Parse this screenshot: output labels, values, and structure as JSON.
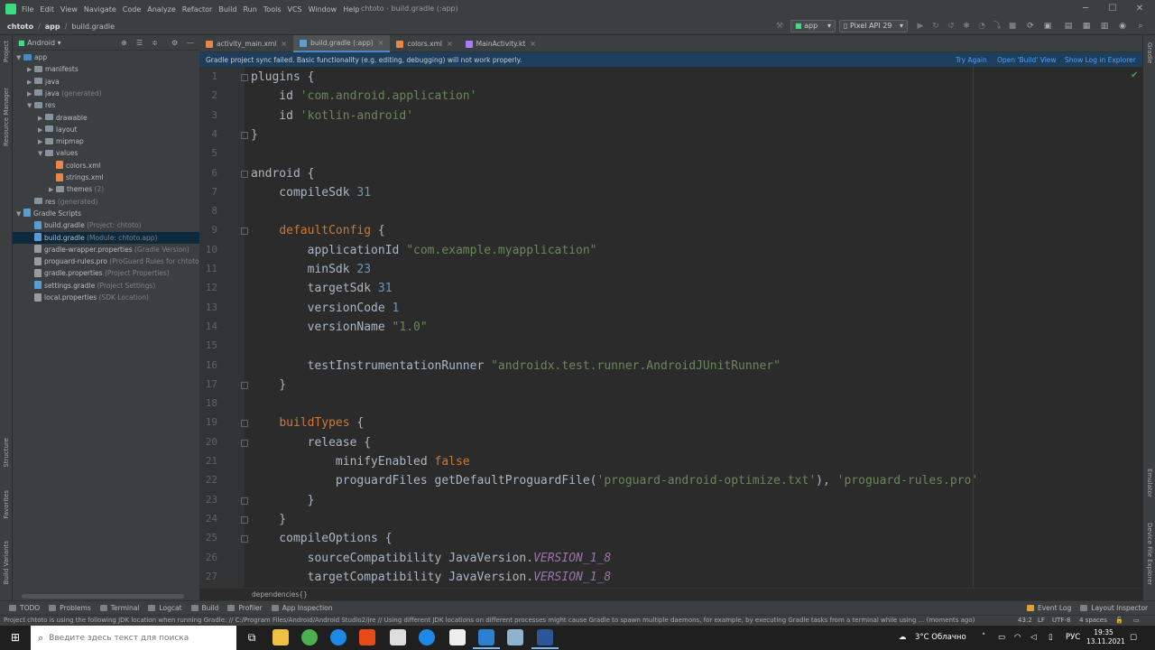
{
  "window": {
    "title": "chtoto - build.gradle (:app)",
    "menu": [
      "File",
      "Edit",
      "View",
      "Navigate",
      "Code",
      "Analyze",
      "Refactor",
      "Build",
      "Run",
      "Tools",
      "VCS",
      "Window",
      "Help"
    ],
    "controls": {
      "minimize": "─",
      "maximize": "☐",
      "close": "✕"
    }
  },
  "navbar": {
    "breadcrumbs": [
      "chtoto",
      "app",
      "build.gradle"
    ],
    "run_config": "app",
    "device": "Pixel API 29"
  },
  "sidebar_left": {
    "project": "Project",
    "resource_manager": "Resource Manager",
    "structure": "Structure",
    "favorites": "Favorites",
    "build_variants": "Build Variants"
  },
  "sidebar_right": {
    "gradle": "Gradle",
    "emulator": "Emulator",
    "device_explorer": "Device File Explorer"
  },
  "project_panel": {
    "view_mode": "Android",
    "tree": [
      {
        "label": "app",
        "hint": "",
        "indent": 0,
        "arrow": "▼",
        "icon": "folder-blue"
      },
      {
        "label": "manifests",
        "hint": "",
        "indent": 1,
        "arrow": "▶",
        "icon": "folder"
      },
      {
        "label": "java",
        "hint": "",
        "indent": 1,
        "arrow": "▶",
        "icon": "folder"
      },
      {
        "label": "java",
        "hint": " (generated)",
        "indent": 1,
        "arrow": "▶",
        "icon": "folder"
      },
      {
        "label": "res",
        "hint": "",
        "indent": 1,
        "arrow": "▼",
        "icon": "folder"
      },
      {
        "label": "drawable",
        "hint": "",
        "indent": 2,
        "arrow": "▶",
        "icon": "folder"
      },
      {
        "label": "layout",
        "hint": "",
        "indent": 2,
        "arrow": "▶",
        "icon": "folder"
      },
      {
        "label": "mipmap",
        "hint": "",
        "indent": 2,
        "arrow": "▶",
        "icon": "folder"
      },
      {
        "label": "values",
        "hint": "",
        "indent": 2,
        "arrow": "▼",
        "icon": "folder"
      },
      {
        "label": "colors.xml",
        "hint": "",
        "indent": 3,
        "arrow": "",
        "icon": "xml"
      },
      {
        "label": "strings.xml",
        "hint": "",
        "indent": 3,
        "arrow": "",
        "icon": "xml"
      },
      {
        "label": "themes",
        "hint": " (2)",
        "indent": 3,
        "arrow": "▶",
        "icon": "folder"
      },
      {
        "label": "res",
        "hint": " (generated)",
        "indent": 1,
        "arrow": "",
        "icon": "folder"
      },
      {
        "label": "Gradle Scripts",
        "hint": "",
        "indent": 0,
        "arrow": "▼",
        "icon": "gradle"
      },
      {
        "label": "build.gradle",
        "hint": " (Project: chtoto)",
        "indent": 1,
        "arrow": "",
        "icon": "gradle"
      },
      {
        "label": "build.gradle",
        "hint": " (Module: chtoto.app)",
        "indent": 1,
        "arrow": "",
        "icon": "gradle",
        "selected": true
      },
      {
        "label": "gradle-wrapper.properties",
        "hint": " (Gradle Version)",
        "indent": 1,
        "arrow": "",
        "icon": "props"
      },
      {
        "label": "proguard-rules.pro",
        "hint": " (ProGuard Rules for chtoto",
        "indent": 1,
        "arrow": "",
        "icon": "props"
      },
      {
        "label": "gradle.properties",
        "hint": " (Project Properties)",
        "indent": 1,
        "arrow": "",
        "icon": "props"
      },
      {
        "label": "settings.gradle",
        "hint": " (Project Settings)",
        "indent": 1,
        "arrow": "",
        "icon": "gradle"
      },
      {
        "label": "local.properties",
        "hint": " (SDK Location)",
        "indent": 1,
        "arrow": "",
        "icon": "props"
      }
    ]
  },
  "tabs": [
    {
      "label": "activity_main.xml",
      "color": "#e8864a",
      "active": false
    },
    {
      "label": "build.gradle (:app)",
      "color": "#5a9bd0",
      "active": true
    },
    {
      "label": "colors.xml",
      "color": "#e8864a",
      "active": false
    },
    {
      "label": "MainActivity.kt",
      "color": "#a97bff",
      "active": false
    }
  ],
  "banner": {
    "message": "Gradle project sync failed. Basic functionality (e.g. editing, debugging) will not work properly.",
    "try_again": "Try Again",
    "open_build": "Open 'Build' View",
    "show_log": "Show Log in Explorer"
  },
  "code_lines": [
    [
      [
        "i",
        "plugins {"
      ]
    ],
    [
      [
        "i",
        "    id "
      ],
      [
        "s",
        "'com.android.application'"
      ]
    ],
    [
      [
        "i",
        "    id "
      ],
      [
        "s",
        "'kotlin-android'"
      ]
    ],
    [
      [
        "i",
        "}"
      ]
    ],
    [],
    [
      [
        "i",
        "android {"
      ]
    ],
    [
      [
        "i",
        "    compileSdk "
      ],
      [
        "n",
        "31"
      ]
    ],
    [],
    [
      [
        "i",
        "    "
      ],
      [
        "k",
        "defaultConfig"
      ],
      [
        "i",
        " {"
      ]
    ],
    [
      [
        "i",
        "        applicationId "
      ],
      [
        "s",
        "\"com.example.myapplication\""
      ]
    ],
    [
      [
        "i",
        "        minSdk "
      ],
      [
        "n",
        "23"
      ]
    ],
    [
      [
        "i",
        "        targetSdk "
      ],
      [
        "n",
        "31"
      ]
    ],
    [
      [
        "i",
        "        versionCode "
      ],
      [
        "n",
        "1"
      ]
    ],
    [
      [
        "i",
        "        versionName "
      ],
      [
        "s",
        "\"1.0\""
      ]
    ],
    [],
    [
      [
        "i",
        "        testInstrumentationRunner "
      ],
      [
        "s",
        "\"androidx.test.runner.AndroidJUnitRunner\""
      ]
    ],
    [
      [
        "i",
        "    }"
      ]
    ],
    [],
    [
      [
        "i",
        "    "
      ],
      [
        "k",
        "buildTypes"
      ],
      [
        "i",
        " {"
      ]
    ],
    [
      [
        "i",
        "        release {"
      ]
    ],
    [
      [
        "i",
        "            minifyEnabled "
      ],
      [
        "k",
        "false"
      ]
    ],
    [
      [
        "i",
        "            proguardFiles getDefaultProguardFile("
      ],
      [
        "s",
        "'proguard-android-optimize.txt'"
      ],
      [
        "i",
        "), "
      ],
      [
        "s",
        "'proguard-rules.pro'"
      ]
    ],
    [
      [
        "i",
        "        }"
      ]
    ],
    [
      [
        "i",
        "    }"
      ]
    ],
    [
      [
        "i",
        "    compileOptions {"
      ]
    ],
    [
      [
        "i",
        "        sourceCompatibility JavaVersion."
      ],
      [
        "v",
        "VERSION_1_8"
      ]
    ],
    [
      [
        "i",
        "        targetCompatibility JavaVersion."
      ],
      [
        "v",
        "VERSION_1_8"
      ]
    ]
  ],
  "editor_breadcrumb": "dependencies{}",
  "bottom_tools": [
    "TODO",
    "Problems",
    "Terminal",
    "Logcat",
    "Build",
    "Profiler",
    "App Inspection"
  ],
  "bottom_right_tools": [
    "Event Log",
    "Layout Inspector"
  ],
  "status": {
    "message": "Project chtoto is using the following JDK location when running Gradle: // C:/Program Files/Android/Android Studio2/jre // Using different JDK locations on different processes might cause Gradle to spawn multiple daemons, for example, by executing Gradle tasks from a terminal while using ... (moments ago)",
    "position": "43:2",
    "line_sep": "LF",
    "encoding": "UTF-8",
    "indent": "4 spaces"
  },
  "taskbar": {
    "search_placeholder": "Введите здесь текст для поиска",
    "weather": "3°C Облачно",
    "lang": "РУС",
    "time": "19:35",
    "date": "13.11.2021"
  }
}
